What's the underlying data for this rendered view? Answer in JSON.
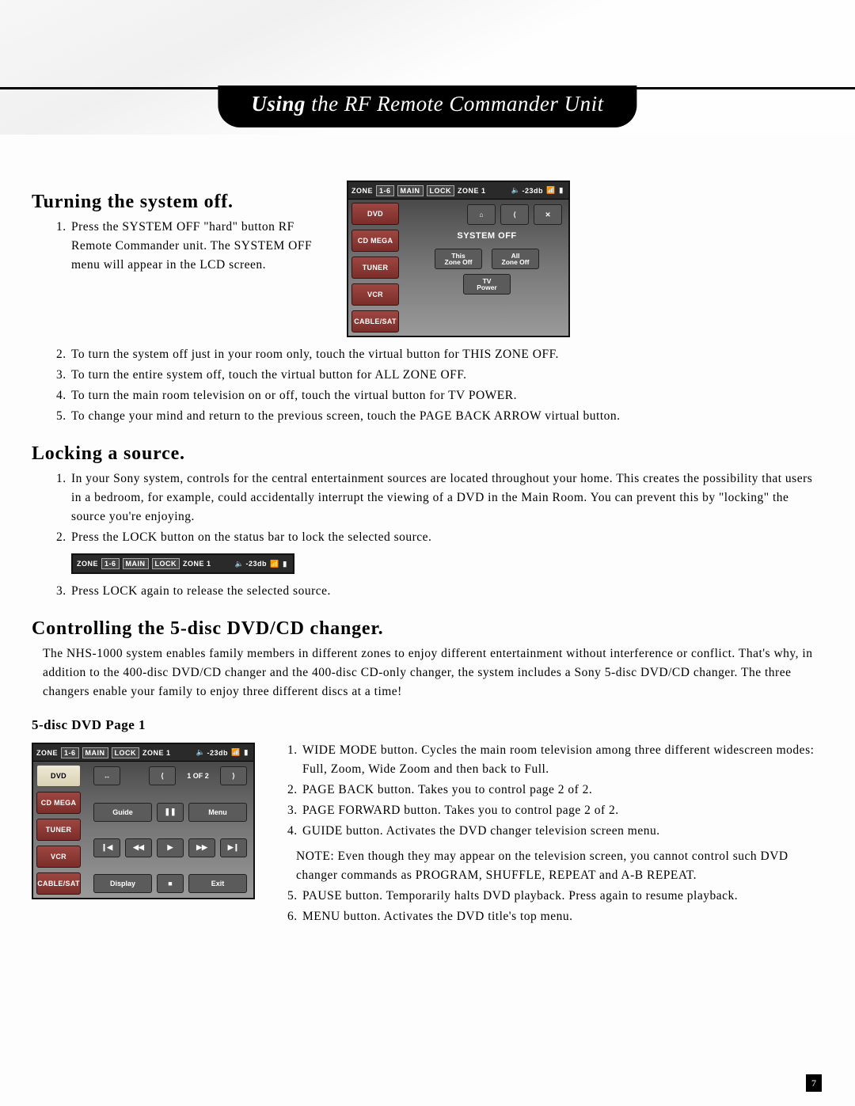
{
  "header": {
    "title_strong": "Using",
    "title_rest": " the RF Remote Commander Unit"
  },
  "section1": {
    "heading": "Turning the system off.",
    "list1": [
      "Press the SYSTEM OFF \"hard\" button RF Remote Commander unit.  The SYSTEM OFF menu will appear in the LCD screen."
    ],
    "list1_cont": [
      "To turn the system off just in your room only, touch the virtual button for THIS ZONE OFF.",
      "To turn the entire system off, touch the virtual button for ALL ZONE OFF.",
      "To turn the main room television on or off, touch the virtual button for TV POWER.",
      "To change your mind and return to the previous screen, touch the PAGE BACK ARROW virtual button."
    ]
  },
  "screen1": {
    "status": {
      "zone_label": "ZONE",
      "zone_range": "1-6",
      "main": "MAIN",
      "lock": "LOCK",
      "zone_sel": "ZONE 1",
      "vol": "-23db"
    },
    "sources": [
      {
        "label": "DVD",
        "active": false
      },
      {
        "label": "CD MEGA",
        "active": false
      },
      {
        "label": "TUNER",
        "active": false
      },
      {
        "label": "VCR",
        "active": false
      },
      {
        "label": "CABLE/SAT",
        "active": false
      }
    ],
    "main_title": "System Off",
    "top_icons": {
      "home": "⌂",
      "back": "⟨",
      "tools": "✕"
    },
    "zone_btns": {
      "this_off_1": "This",
      "this_off_2": "Zone Off",
      "all_off_1": "All",
      "all_off_2": "Zone Off"
    },
    "tv_btn": {
      "l1": "TV",
      "l2": "Power"
    }
  },
  "section2": {
    "heading": "Locking a source.",
    "list": [
      "In your Sony system, controls for the central entertainment sources are located throughout your home.  This creates the possibility that users in a bedroom, for example, could accidentally interrupt the viewing of a DVD in the Main Room.  You can prevent this by \"locking\" the source you're enjoying.",
      "Press the LOCK button on the status bar to lock the selected source."
    ],
    "list_cont": [
      "Press LOCK again to release the selected source."
    ]
  },
  "strip": {
    "zone_label": "ZONE",
    "zone_range": "1-6",
    "main": "MAIN",
    "lock": "LOCK",
    "zone_sel": "ZONE 1",
    "vol": "-23db"
  },
  "section3": {
    "heading": "Controlling the 5-disc DVD/CD changer.",
    "para": "The NHS-1000 system enables family members in different zones to enjoy different entertainment without interference or conflict.  That's why, in addition to the 400-disc DVD/CD changer and the 400-disc CD-only changer, the system includes a Sony 5-disc DVD/CD changer.  The three changers enable your family to enjoy three different discs at a time!",
    "sub": "5-disc DVD Page 1",
    "list": [
      "WIDE MODE button.  Cycles the main room television among three different widescreen modes: Full, Zoom, Wide Zoom and then back to Full.",
      "PAGE BACK button.  Takes you to control page 2 of 2.",
      "PAGE FORWARD button.  Takes you to control page 2 of 2.",
      "GUIDE button.  Activates the DVD changer television screen menu."
    ],
    "note": "NOTE: Even though they may appear on the television screen, you cannot control such DVD changer commands as PROGRAM, SHUFFLE, REPEAT and A-B REPEAT.",
    "list_cont": [
      "PAUSE button.  Temporarily halts DVD playback.  Press again to resume playback.",
      "MENU button.  Activates the DVD title's top menu."
    ]
  },
  "screen3": {
    "status": {
      "zone_label": "ZONE",
      "zone_range": "1-6",
      "main": "MAIN",
      "lock": "LOCK",
      "zone_sel": "ZONE 1",
      "vol": "-23db"
    },
    "sources": [
      {
        "label": "DVD",
        "active": true
      },
      {
        "label": "CD MEGA",
        "active": false
      },
      {
        "label": "TUNER",
        "active": false
      },
      {
        "label": "VCR",
        "active": false
      },
      {
        "label": "CABLE/SAT",
        "active": false
      }
    ],
    "page_label": "1 OF 2",
    "row1": {
      "wide": "↔",
      "back": "⟨",
      "fwd": "⟩"
    },
    "row2": {
      "guide": "Guide",
      "pause": "❚❚",
      "menu": "Menu"
    },
    "row3": {
      "skipb": "❙◀",
      "rew": "◀◀",
      "play": "▶",
      "ff": "▶▶",
      "skipf": "▶❙"
    },
    "row4": {
      "display": "Display",
      "stop": "■",
      "exit": "Exit"
    }
  },
  "page_number": "7"
}
